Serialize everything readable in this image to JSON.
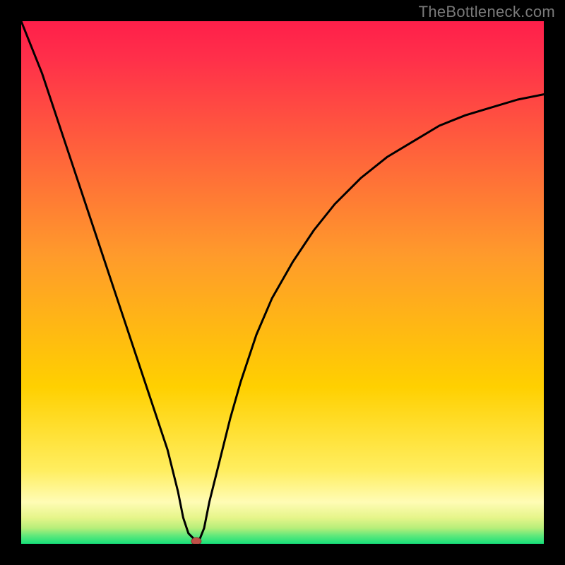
{
  "watermark": "TheBottleneck.com",
  "colors": {
    "frame": "#000000",
    "curve": "#000000",
    "top_gradient": "#ff1f4a",
    "mid_gradient": "#ffd000",
    "low_gradient": "#fff9b0",
    "bottom_gradient": "#16e07a",
    "marker": "#c05048"
  },
  "chart_data": {
    "type": "line",
    "title": "",
    "xlabel": "",
    "ylabel": "",
    "xlim": [
      0,
      100
    ],
    "ylim": [
      0,
      100
    ],
    "x": [
      0,
      2,
      4,
      6,
      8,
      10,
      12,
      14,
      16,
      18,
      20,
      22,
      24,
      26,
      28,
      30,
      31,
      32,
      33,
      33.5,
      34,
      35,
      36,
      38,
      40,
      42,
      45,
      48,
      52,
      56,
      60,
      65,
      70,
      75,
      80,
      85,
      90,
      95,
      100
    ],
    "y": [
      100,
      95,
      90,
      84,
      78,
      72,
      66,
      60,
      54,
      48,
      42,
      36,
      30,
      24,
      18,
      10,
      5,
      2,
      1,
      0.5,
      0.5,
      3,
      8,
      16,
      24,
      31,
      40,
      47,
      54,
      60,
      65,
      70,
      74,
      77,
      80,
      82,
      83.5,
      85,
      86
    ],
    "series": [
      {
        "name": "bottleneck-curve",
        "stroke": "#000000"
      }
    ],
    "marker": {
      "x": 33.5,
      "y": 0.5,
      "label": ""
    },
    "gradient_bands": [
      {
        "y0": 100,
        "y1": 15,
        "color_top": "#ff1f4a",
        "color_bottom": "#ffd000"
      },
      {
        "y0": 15,
        "y1": 6,
        "color_top": "#ffd000",
        "color_bottom": "#fff9b0"
      },
      {
        "y0": 6,
        "y1": 2,
        "color_top": "#fff9b0",
        "color_bottom": "#d8f27a"
      },
      {
        "y0": 2,
        "y1": 0,
        "color_top": "#d8f27a",
        "color_bottom": "#16e07a"
      }
    ]
  }
}
